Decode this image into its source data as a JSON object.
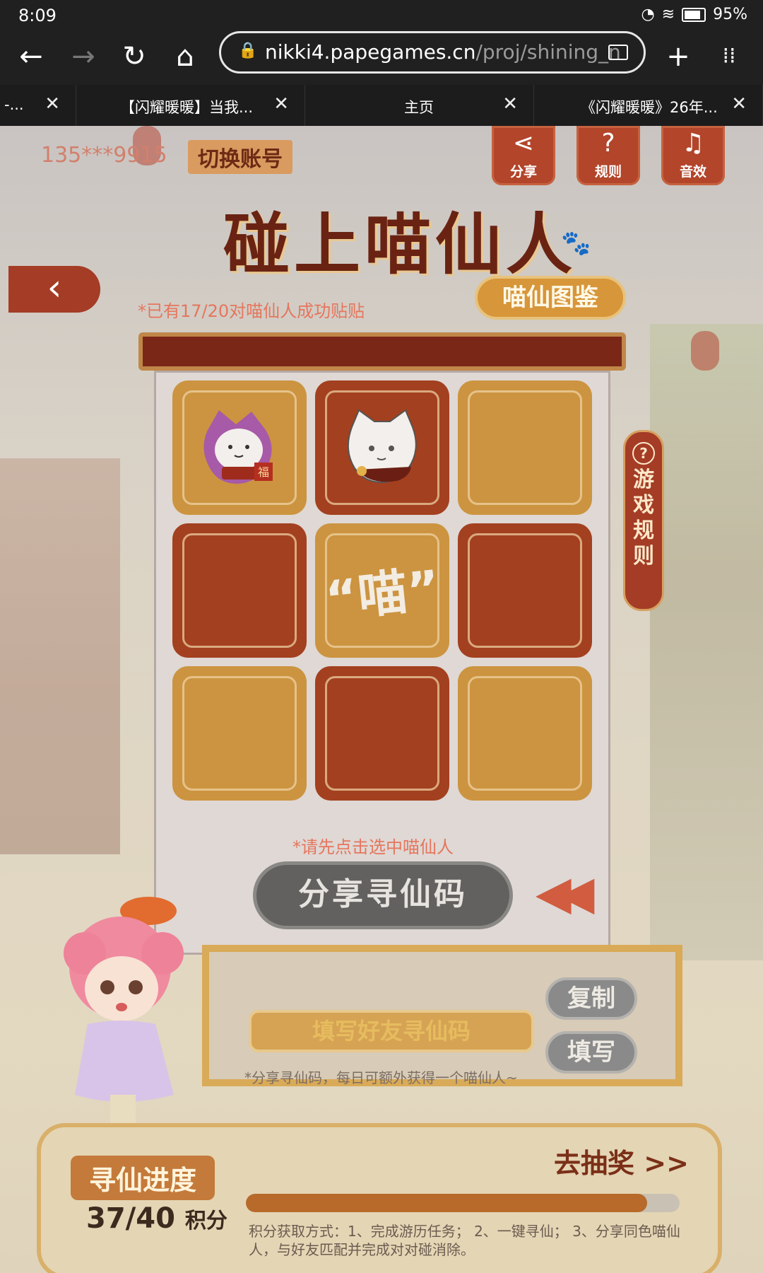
{
  "status": {
    "time": "8:09",
    "battery": "95%"
  },
  "browser": {
    "url_host": "nikki4.papegames.cn",
    "url_path": "/proj/shining_n",
    "tabs": [
      {
        "title": "-..."
      },
      {
        "title": "【闪耀暖暖】当我..."
      },
      {
        "title": "主页"
      },
      {
        "title": "《闪耀暖暖》26年..."
      }
    ]
  },
  "page": {
    "account": "135***9915",
    "switch_account": "切换账号",
    "top_buttons": {
      "share": "分享",
      "rules": "规则",
      "sound": "音效"
    },
    "title": "碰上喵仙人",
    "collection": "喵仙图鉴",
    "count_text": "*已有17/20对喵仙人成功贴贴",
    "side_rules": [
      "游",
      "戏",
      "规",
      "则"
    ],
    "grid": {
      "meow_text": "“喵”",
      "fu": "福",
      "cards": [
        "cat-purple",
        "cat-red",
        "empty",
        "empty",
        "meow",
        "empty",
        "empty",
        "empty",
        "empty"
      ]
    },
    "hint": "*请先点击选中喵仙人",
    "share_code_button": "分享寻仙码",
    "code_input_placeholder": "填写好友寻仙码",
    "copy_button": "复制",
    "fill_button": "填写",
    "share_note": "*分享寻仙码，每日可额外获得一个喵仙人~",
    "progress": {
      "title": "寻仙进度",
      "current": "37",
      "total": "/40",
      "unit": "积分",
      "lottery": "去抽奖 >>",
      "fraction": 0.925,
      "method": "积分获取方式：1、完成游历任务；  2、一键寻仙；  3、分享同色喵仙人，与好友匹配并完成对对碰消除。"
    }
  },
  "colors": {
    "orange_card": "#cc9440",
    "red_card": "#a3401f",
    "accent": "#a43c26"
  }
}
